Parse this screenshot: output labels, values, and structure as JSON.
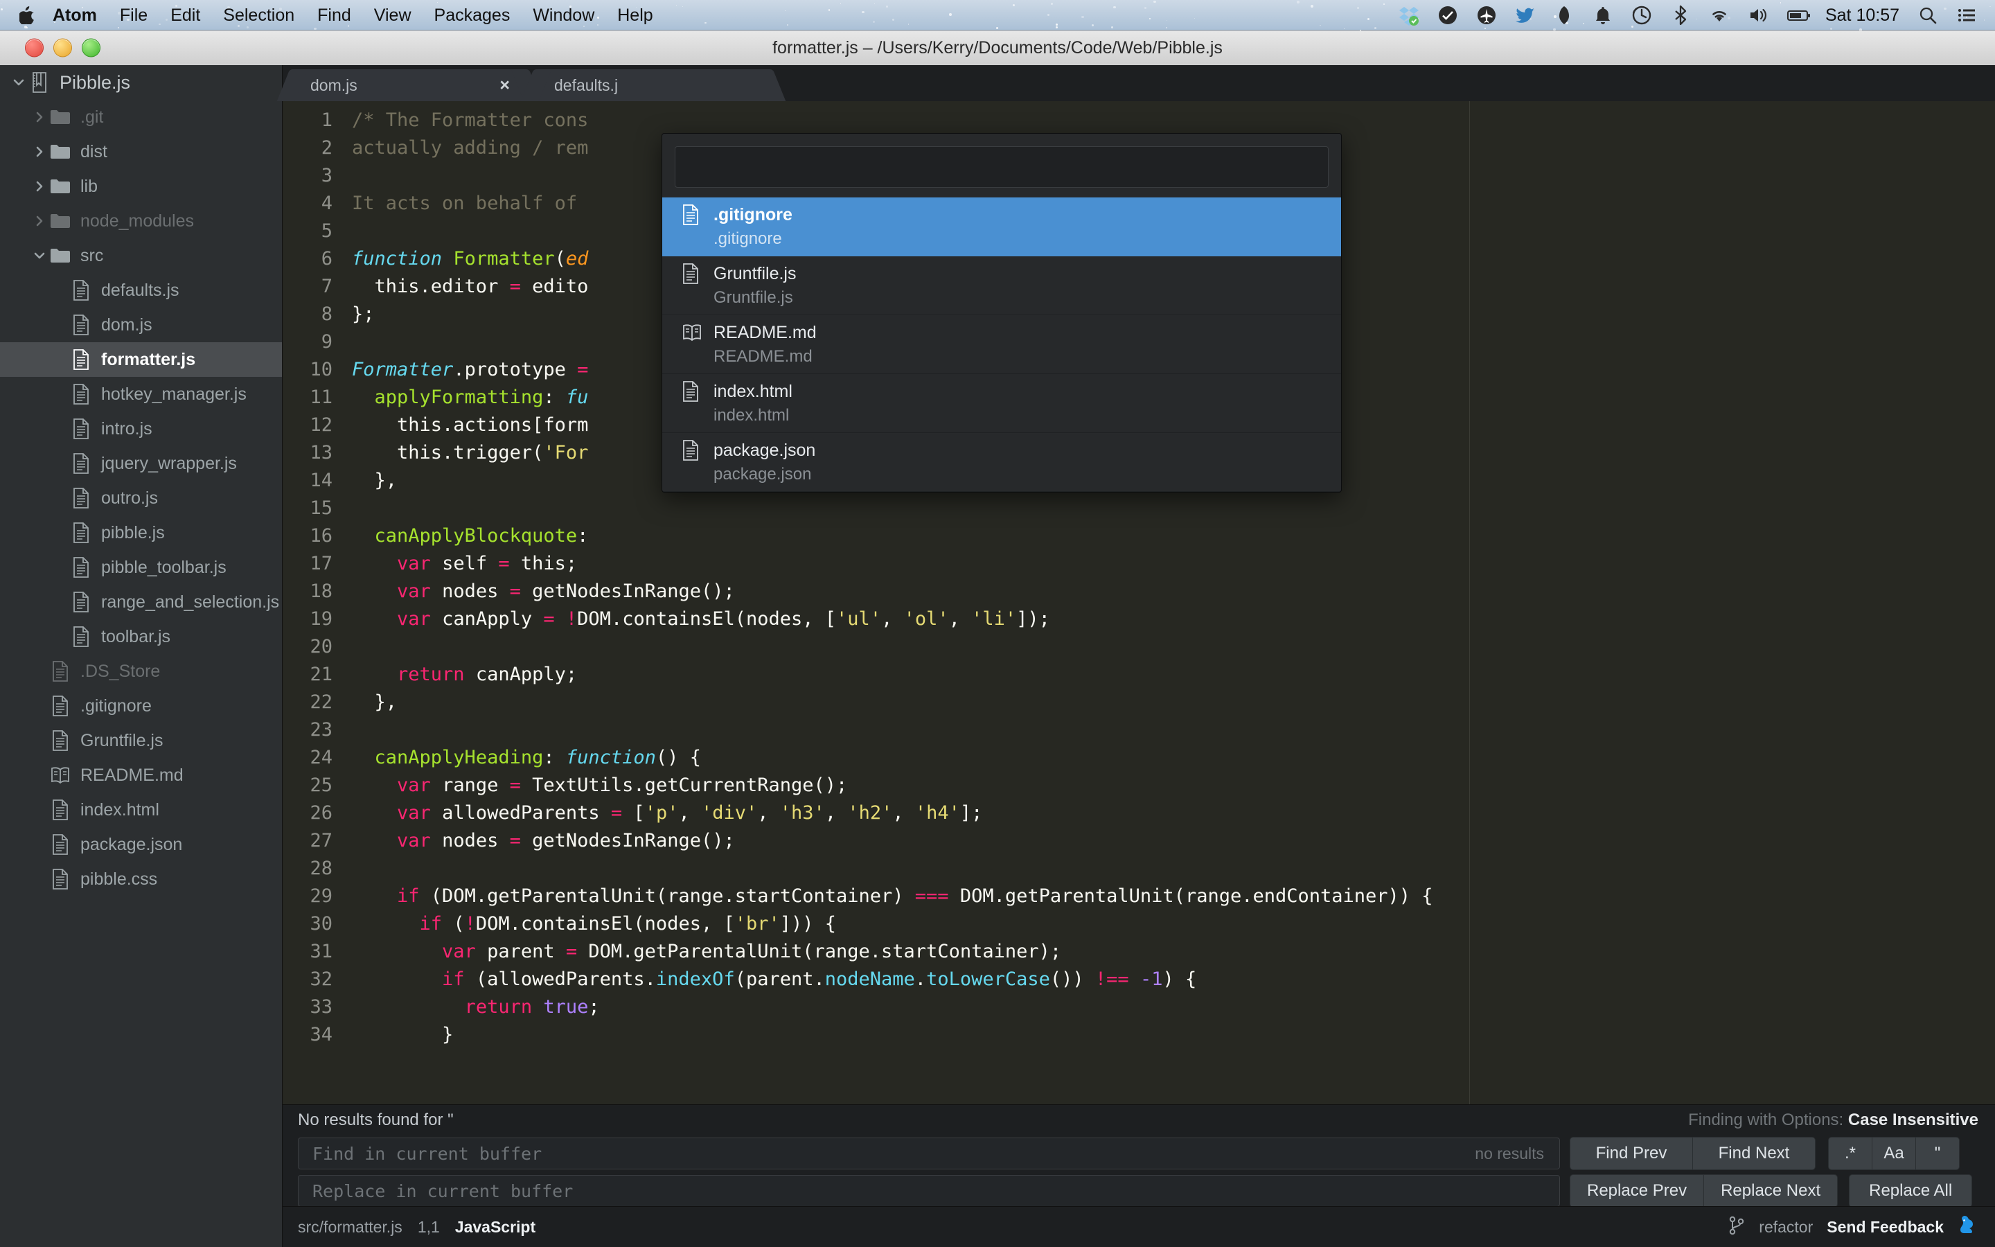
{
  "menubar": {
    "apple_icon": "apple-logo-icon",
    "items": [
      {
        "label": "Atom",
        "bold": true
      },
      {
        "label": "File",
        "bold": false
      },
      {
        "label": "Edit",
        "bold": false
      },
      {
        "label": "Selection",
        "bold": false
      },
      {
        "label": "Find",
        "bold": false
      },
      {
        "label": "View",
        "bold": false
      },
      {
        "label": "Packages",
        "bold": false
      },
      {
        "label": "Window",
        "bold": false
      },
      {
        "label": "Help",
        "bold": false
      }
    ],
    "status_icons": [
      "dropbox-icon",
      "checkmark-badge-icon",
      "airplane-icon",
      "twitter-icon",
      "feather-icon",
      "bell-icon",
      "time-machine-icon",
      "bluetooth-icon",
      "wifi-icon",
      "volume-icon",
      "battery-icon"
    ],
    "clock": "Sat 10:57",
    "search_icon": "spotlight-search-icon",
    "notification_icon": "notification-center-icon"
  },
  "window": {
    "title": "formatter.js – /Users/Kerry/Documents/Code/Web/Pibble.js",
    "traffic_lights": [
      "close-button",
      "minimize-button",
      "zoom-button"
    ]
  },
  "sidebar": {
    "items": [
      {
        "label": "Pibble.js",
        "depth": 0,
        "kind": "project",
        "twisty": "down",
        "dim": false,
        "selected": false
      },
      {
        "label": ".git",
        "depth": 1,
        "kind": "folder",
        "twisty": "right",
        "dim": true,
        "selected": false
      },
      {
        "label": "dist",
        "depth": 1,
        "kind": "folder",
        "twisty": "right",
        "dim": false,
        "selected": false
      },
      {
        "label": "lib",
        "depth": 1,
        "kind": "folder",
        "twisty": "right",
        "dim": false,
        "selected": false
      },
      {
        "label": "node_modules",
        "depth": 1,
        "kind": "folder",
        "twisty": "right",
        "dim": true,
        "selected": false
      },
      {
        "label": "src",
        "depth": 1,
        "kind": "folder",
        "twisty": "down",
        "dim": false,
        "selected": false
      },
      {
        "label": "defaults.js",
        "depth": 2,
        "kind": "file",
        "twisty": "none",
        "dim": false,
        "selected": false
      },
      {
        "label": "dom.js",
        "depth": 2,
        "kind": "file",
        "twisty": "none",
        "dim": false,
        "selected": false
      },
      {
        "label": "formatter.js",
        "depth": 2,
        "kind": "file",
        "twisty": "none",
        "dim": false,
        "selected": true
      },
      {
        "label": "hotkey_manager.js",
        "depth": 2,
        "kind": "file",
        "twisty": "none",
        "dim": false,
        "selected": false
      },
      {
        "label": "intro.js",
        "depth": 2,
        "kind": "file",
        "twisty": "none",
        "dim": false,
        "selected": false
      },
      {
        "label": "jquery_wrapper.js",
        "depth": 2,
        "kind": "file",
        "twisty": "none",
        "dim": false,
        "selected": false
      },
      {
        "label": "outro.js",
        "depth": 2,
        "kind": "file",
        "twisty": "none",
        "dim": false,
        "selected": false
      },
      {
        "label": "pibble.js",
        "depth": 2,
        "kind": "file",
        "twisty": "none",
        "dim": false,
        "selected": false
      },
      {
        "label": "pibble_toolbar.js",
        "depth": 2,
        "kind": "file",
        "twisty": "none",
        "dim": false,
        "selected": false
      },
      {
        "label": "range_and_selection.js",
        "depth": 2,
        "kind": "file",
        "twisty": "none",
        "dim": false,
        "selected": false
      },
      {
        "label": "toolbar.js",
        "depth": 2,
        "kind": "file",
        "twisty": "none",
        "dim": false,
        "selected": false
      },
      {
        "label": ".DS_Store",
        "depth": 1,
        "kind": "file",
        "twisty": "none",
        "dim": true,
        "selected": false
      },
      {
        "label": ".gitignore",
        "depth": 1,
        "kind": "file",
        "twisty": "none",
        "dim": false,
        "selected": false
      },
      {
        "label": "Gruntfile.js",
        "depth": 1,
        "kind": "file",
        "twisty": "none",
        "dim": false,
        "selected": false
      },
      {
        "label": "README.md",
        "depth": 1,
        "kind": "book",
        "twisty": "none",
        "dim": false,
        "selected": false
      },
      {
        "label": "index.html",
        "depth": 1,
        "kind": "file",
        "twisty": "none",
        "dim": false,
        "selected": false
      },
      {
        "label": "package.json",
        "depth": 1,
        "kind": "file",
        "twisty": "none",
        "dim": false,
        "selected": false
      },
      {
        "label": "pibble.css",
        "depth": 1,
        "kind": "file",
        "twisty": "none",
        "dim": false,
        "selected": false
      }
    ]
  },
  "tabs": [
    {
      "label": "dom.js",
      "close": "×",
      "active": false
    },
    {
      "label": "defaults.j",
      "close": "",
      "active": false
    }
  ],
  "editor": {
    "first_line": 1,
    "lines": [
      {
        "n": 1,
        "tokens": [
          {
            "t": "/* The Formatter cons",
            "c": "k-com"
          }
        ]
      },
      {
        "n": 2,
        "tokens": [
          {
            "t": "actually adding / rem",
            "c": "k-com"
          }
        ]
      },
      {
        "n": 3,
        "tokens": []
      },
      {
        "n": 4,
        "tokens": [
          {
            "t": "It acts on behalf of ",
            "c": "k-com"
          }
        ]
      },
      {
        "n": 5,
        "tokens": []
      },
      {
        "n": 6,
        "tokens": [
          {
            "t": "function",
            "c": "k-cyan-i"
          },
          {
            "t": " ",
            "c": "k-txt"
          },
          {
            "t": "Formatter",
            "c": "k-fn"
          },
          {
            "t": "(",
            "c": "k-txt"
          },
          {
            "t": "ed",
            "c": "k-orange-i"
          }
        ]
      },
      {
        "n": 7,
        "tokens": [
          {
            "t": "  this.editor ",
            "c": "k-txt"
          },
          {
            "t": "=",
            "c": "k-op"
          },
          {
            "t": " edito",
            "c": "k-txt"
          }
        ]
      },
      {
        "n": 8,
        "tokens": [
          {
            "t": "};",
            "c": "k-txt"
          }
        ]
      },
      {
        "n": 9,
        "tokens": []
      },
      {
        "n": 10,
        "tokens": [
          {
            "t": "Formatter",
            "c": "k-cyan-i"
          },
          {
            "t": ".prototype ",
            "c": "k-txt"
          },
          {
            "t": "=",
            "c": "k-op"
          }
        ]
      },
      {
        "n": 11,
        "tokens": [
          {
            "t": "  ",
            "c": "k-txt"
          },
          {
            "t": "applyFormatting",
            "c": "k-fn"
          },
          {
            "t": ": ",
            "c": "k-txt"
          },
          {
            "t": "fu",
            "c": "k-cyan-i"
          }
        ]
      },
      {
        "n": 12,
        "tokens": [
          {
            "t": "    this.actions[form",
            "c": "k-txt"
          }
        ]
      },
      {
        "n": 13,
        "tokens": [
          {
            "t": "    this.trigger(",
            "c": "k-txt"
          },
          {
            "t": "'For",
            "c": "k-str"
          }
        ]
      },
      {
        "n": 14,
        "tokens": [
          {
            "t": "  },",
            "c": "k-txt"
          }
        ]
      },
      {
        "n": 15,
        "tokens": []
      },
      {
        "n": 16,
        "tokens": [
          {
            "t": "  ",
            "c": "k-txt"
          },
          {
            "t": "canApplyBlockquote",
            "c": "k-fn"
          },
          {
            "t": ":",
            "c": "k-txt"
          }
        ]
      },
      {
        "n": 17,
        "tokens": [
          {
            "t": "    ",
            "c": "k-txt"
          },
          {
            "t": "var",
            "c": "k-var"
          },
          {
            "t": " self ",
            "c": "k-txt"
          },
          {
            "t": "=",
            "c": "k-op"
          },
          {
            "t": " this;",
            "c": "k-txt"
          }
        ]
      },
      {
        "n": 18,
        "tokens": [
          {
            "t": "    ",
            "c": "k-txt"
          },
          {
            "t": "var",
            "c": "k-var"
          },
          {
            "t": " nodes ",
            "c": "k-txt"
          },
          {
            "t": "=",
            "c": "k-op"
          },
          {
            "t": " getNodesInRange();",
            "c": "k-txt"
          }
        ]
      },
      {
        "n": 19,
        "tokens": [
          {
            "t": "    ",
            "c": "k-txt"
          },
          {
            "t": "var",
            "c": "k-var"
          },
          {
            "t": " canApply ",
            "c": "k-txt"
          },
          {
            "t": "=",
            "c": "k-op"
          },
          {
            "t": " ",
            "c": "k-txt"
          },
          {
            "t": "!",
            "c": "k-op"
          },
          {
            "t": "DOM.containsEl(nodes, [",
            "c": "k-txt"
          },
          {
            "t": "'ul'",
            "c": "k-str"
          },
          {
            "t": ", ",
            "c": "k-txt"
          },
          {
            "t": "'ol'",
            "c": "k-str"
          },
          {
            "t": ", ",
            "c": "k-txt"
          },
          {
            "t": "'li'",
            "c": "k-str"
          },
          {
            "t": "]);",
            "c": "k-txt"
          }
        ]
      },
      {
        "n": 20,
        "tokens": []
      },
      {
        "n": 21,
        "tokens": [
          {
            "t": "    ",
            "c": "k-txt"
          },
          {
            "t": "return",
            "c": "k-var"
          },
          {
            "t": " canApply;",
            "c": "k-txt"
          }
        ]
      },
      {
        "n": 22,
        "tokens": [
          {
            "t": "  },",
            "c": "k-txt"
          }
        ]
      },
      {
        "n": 23,
        "tokens": []
      },
      {
        "n": 24,
        "tokens": [
          {
            "t": "  ",
            "c": "k-txt"
          },
          {
            "t": "canApplyHeading",
            "c": "k-fn"
          },
          {
            "t": ": ",
            "c": "k-txt"
          },
          {
            "t": "function",
            "c": "k-cyan-i"
          },
          {
            "t": "() {",
            "c": "k-txt"
          }
        ]
      },
      {
        "n": 25,
        "tokens": [
          {
            "t": "    ",
            "c": "k-txt"
          },
          {
            "t": "var",
            "c": "k-var"
          },
          {
            "t": " range ",
            "c": "k-txt"
          },
          {
            "t": "=",
            "c": "k-op"
          },
          {
            "t": " TextUtils.getCurrentRange();",
            "c": "k-txt"
          }
        ]
      },
      {
        "n": 26,
        "tokens": [
          {
            "t": "    ",
            "c": "k-txt"
          },
          {
            "t": "var",
            "c": "k-var"
          },
          {
            "t": " allowedParents ",
            "c": "k-txt"
          },
          {
            "t": "=",
            "c": "k-op"
          },
          {
            "t": " [",
            "c": "k-txt"
          },
          {
            "t": "'p'",
            "c": "k-str"
          },
          {
            "t": ", ",
            "c": "k-txt"
          },
          {
            "t": "'div'",
            "c": "k-str"
          },
          {
            "t": ", ",
            "c": "k-txt"
          },
          {
            "t": "'h3'",
            "c": "k-str"
          },
          {
            "t": ", ",
            "c": "k-txt"
          },
          {
            "t": "'h2'",
            "c": "k-str"
          },
          {
            "t": ", ",
            "c": "k-txt"
          },
          {
            "t": "'h4'",
            "c": "k-str"
          },
          {
            "t": "];",
            "c": "k-txt"
          }
        ]
      },
      {
        "n": 27,
        "tokens": [
          {
            "t": "    ",
            "c": "k-txt"
          },
          {
            "t": "var",
            "c": "k-var"
          },
          {
            "t": " nodes ",
            "c": "k-txt"
          },
          {
            "t": "=",
            "c": "k-op"
          },
          {
            "t": " getNodesInRange();",
            "c": "k-txt"
          }
        ]
      },
      {
        "n": 28,
        "tokens": []
      },
      {
        "n": 29,
        "tokens": [
          {
            "t": "    ",
            "c": "k-txt"
          },
          {
            "t": "if",
            "c": "k-var"
          },
          {
            "t": " (DOM.getParentalUnit(range.startContainer) ",
            "c": "k-txt"
          },
          {
            "t": "===",
            "c": "k-op"
          },
          {
            "t": " DOM.getParentalUnit(range.endContainer)) {",
            "c": "k-txt"
          }
        ]
      },
      {
        "n": 30,
        "tokens": [
          {
            "t": "      ",
            "c": "k-txt"
          },
          {
            "t": "if",
            "c": "k-var"
          },
          {
            "t": " (",
            "c": "k-txt"
          },
          {
            "t": "!",
            "c": "k-op"
          },
          {
            "t": "DOM.containsEl(nodes, [",
            "c": "k-txt"
          },
          {
            "t": "'br'",
            "c": "k-str"
          },
          {
            "t": "])) {",
            "c": "k-txt"
          }
        ]
      },
      {
        "n": 31,
        "tokens": [
          {
            "t": "        ",
            "c": "k-txt"
          },
          {
            "t": "var",
            "c": "k-var"
          },
          {
            "t": " parent ",
            "c": "k-txt"
          },
          {
            "t": "=",
            "c": "k-op"
          },
          {
            "t": " DOM.getParentalUnit(range.startContainer);",
            "c": "k-txt"
          }
        ]
      },
      {
        "n": 32,
        "tokens": [
          {
            "t": "        ",
            "c": "k-txt"
          },
          {
            "t": "if",
            "c": "k-var"
          },
          {
            "t": " (allowedParents.",
            "c": "k-txt"
          },
          {
            "t": "indexOf",
            "c": "k-prop"
          },
          {
            "t": "(parent.",
            "c": "k-txt"
          },
          {
            "t": "nodeName",
            "c": "k-prop"
          },
          {
            "t": ".",
            "c": "k-txt"
          },
          {
            "t": "toLowerCase",
            "c": "k-prop"
          },
          {
            "t": "()) ",
            "c": "k-txt"
          },
          {
            "t": "!==",
            "c": "k-op"
          },
          {
            "t": " ",
            "c": "k-txt"
          },
          {
            "t": "-1",
            "c": "k-num"
          },
          {
            "t": ") {",
            "c": "k-txt"
          }
        ]
      },
      {
        "n": 33,
        "tokens": [
          {
            "t": "          ",
            "c": "k-txt"
          },
          {
            "t": "return",
            "c": "k-var"
          },
          {
            "t": " ",
            "c": "k-txt"
          },
          {
            "t": "true",
            "c": "k-num"
          },
          {
            "t": ";",
            "c": "k-txt"
          }
        ]
      },
      {
        "n": 34,
        "tokens": [
          {
            "t": "        }",
            "c": "k-txt"
          }
        ]
      }
    ]
  },
  "fuzzy_finder": {
    "query": "",
    "placeholder": "",
    "results": [
      {
        "name": ".gitignore",
        "path": ".gitignore",
        "icon": "file-icon",
        "selected": true
      },
      {
        "name": "Gruntfile.js",
        "path": "Gruntfile.js",
        "icon": "file-icon",
        "selected": false
      },
      {
        "name": "README.md",
        "path": "README.md",
        "icon": "book-icon",
        "selected": false
      },
      {
        "name": "index.html",
        "path": "index.html",
        "icon": "file-icon",
        "selected": false
      },
      {
        "name": "package.json",
        "path": "package.json",
        "icon": "file-icon",
        "selected": false
      }
    ],
    "selection_color": "#4a90d2"
  },
  "find_panel": {
    "status_message": "No results found for \"",
    "options_label": "Finding with Options:",
    "options_value": "Case Insensitive",
    "find_value": "",
    "find_placeholder": "Find in current buffer",
    "find_result_count": "no results",
    "replace_value": "",
    "replace_placeholder": "Replace in current buffer",
    "find_buttons": [
      {
        "label": "Find Prev",
        "name": "find-prev-button"
      },
      {
        "label": "Find Next",
        "name": "find-next-button"
      }
    ],
    "toggle_buttons": [
      {
        "label": ".*",
        "name": "regex-toggle-button"
      },
      {
        "label": "Aa",
        "name": "case-sensitive-toggle-button"
      },
      {
        "label": "\"",
        "name": "whole-word-toggle-button"
      }
    ],
    "replace_buttons": [
      {
        "label": "Replace Prev",
        "name": "replace-prev-button"
      },
      {
        "label": "Replace Next",
        "name": "replace-next-button"
      }
    ],
    "replace_all_label": "Replace All"
  },
  "status_bar": {
    "file_path": "src/formatter.js",
    "cursor_position": "1,1",
    "grammar": "JavaScript",
    "branch_icon": "git-branch-icon",
    "branch": "refactor",
    "feedback": "Send Feedback",
    "feedback_icon": "squirrel-icon"
  }
}
